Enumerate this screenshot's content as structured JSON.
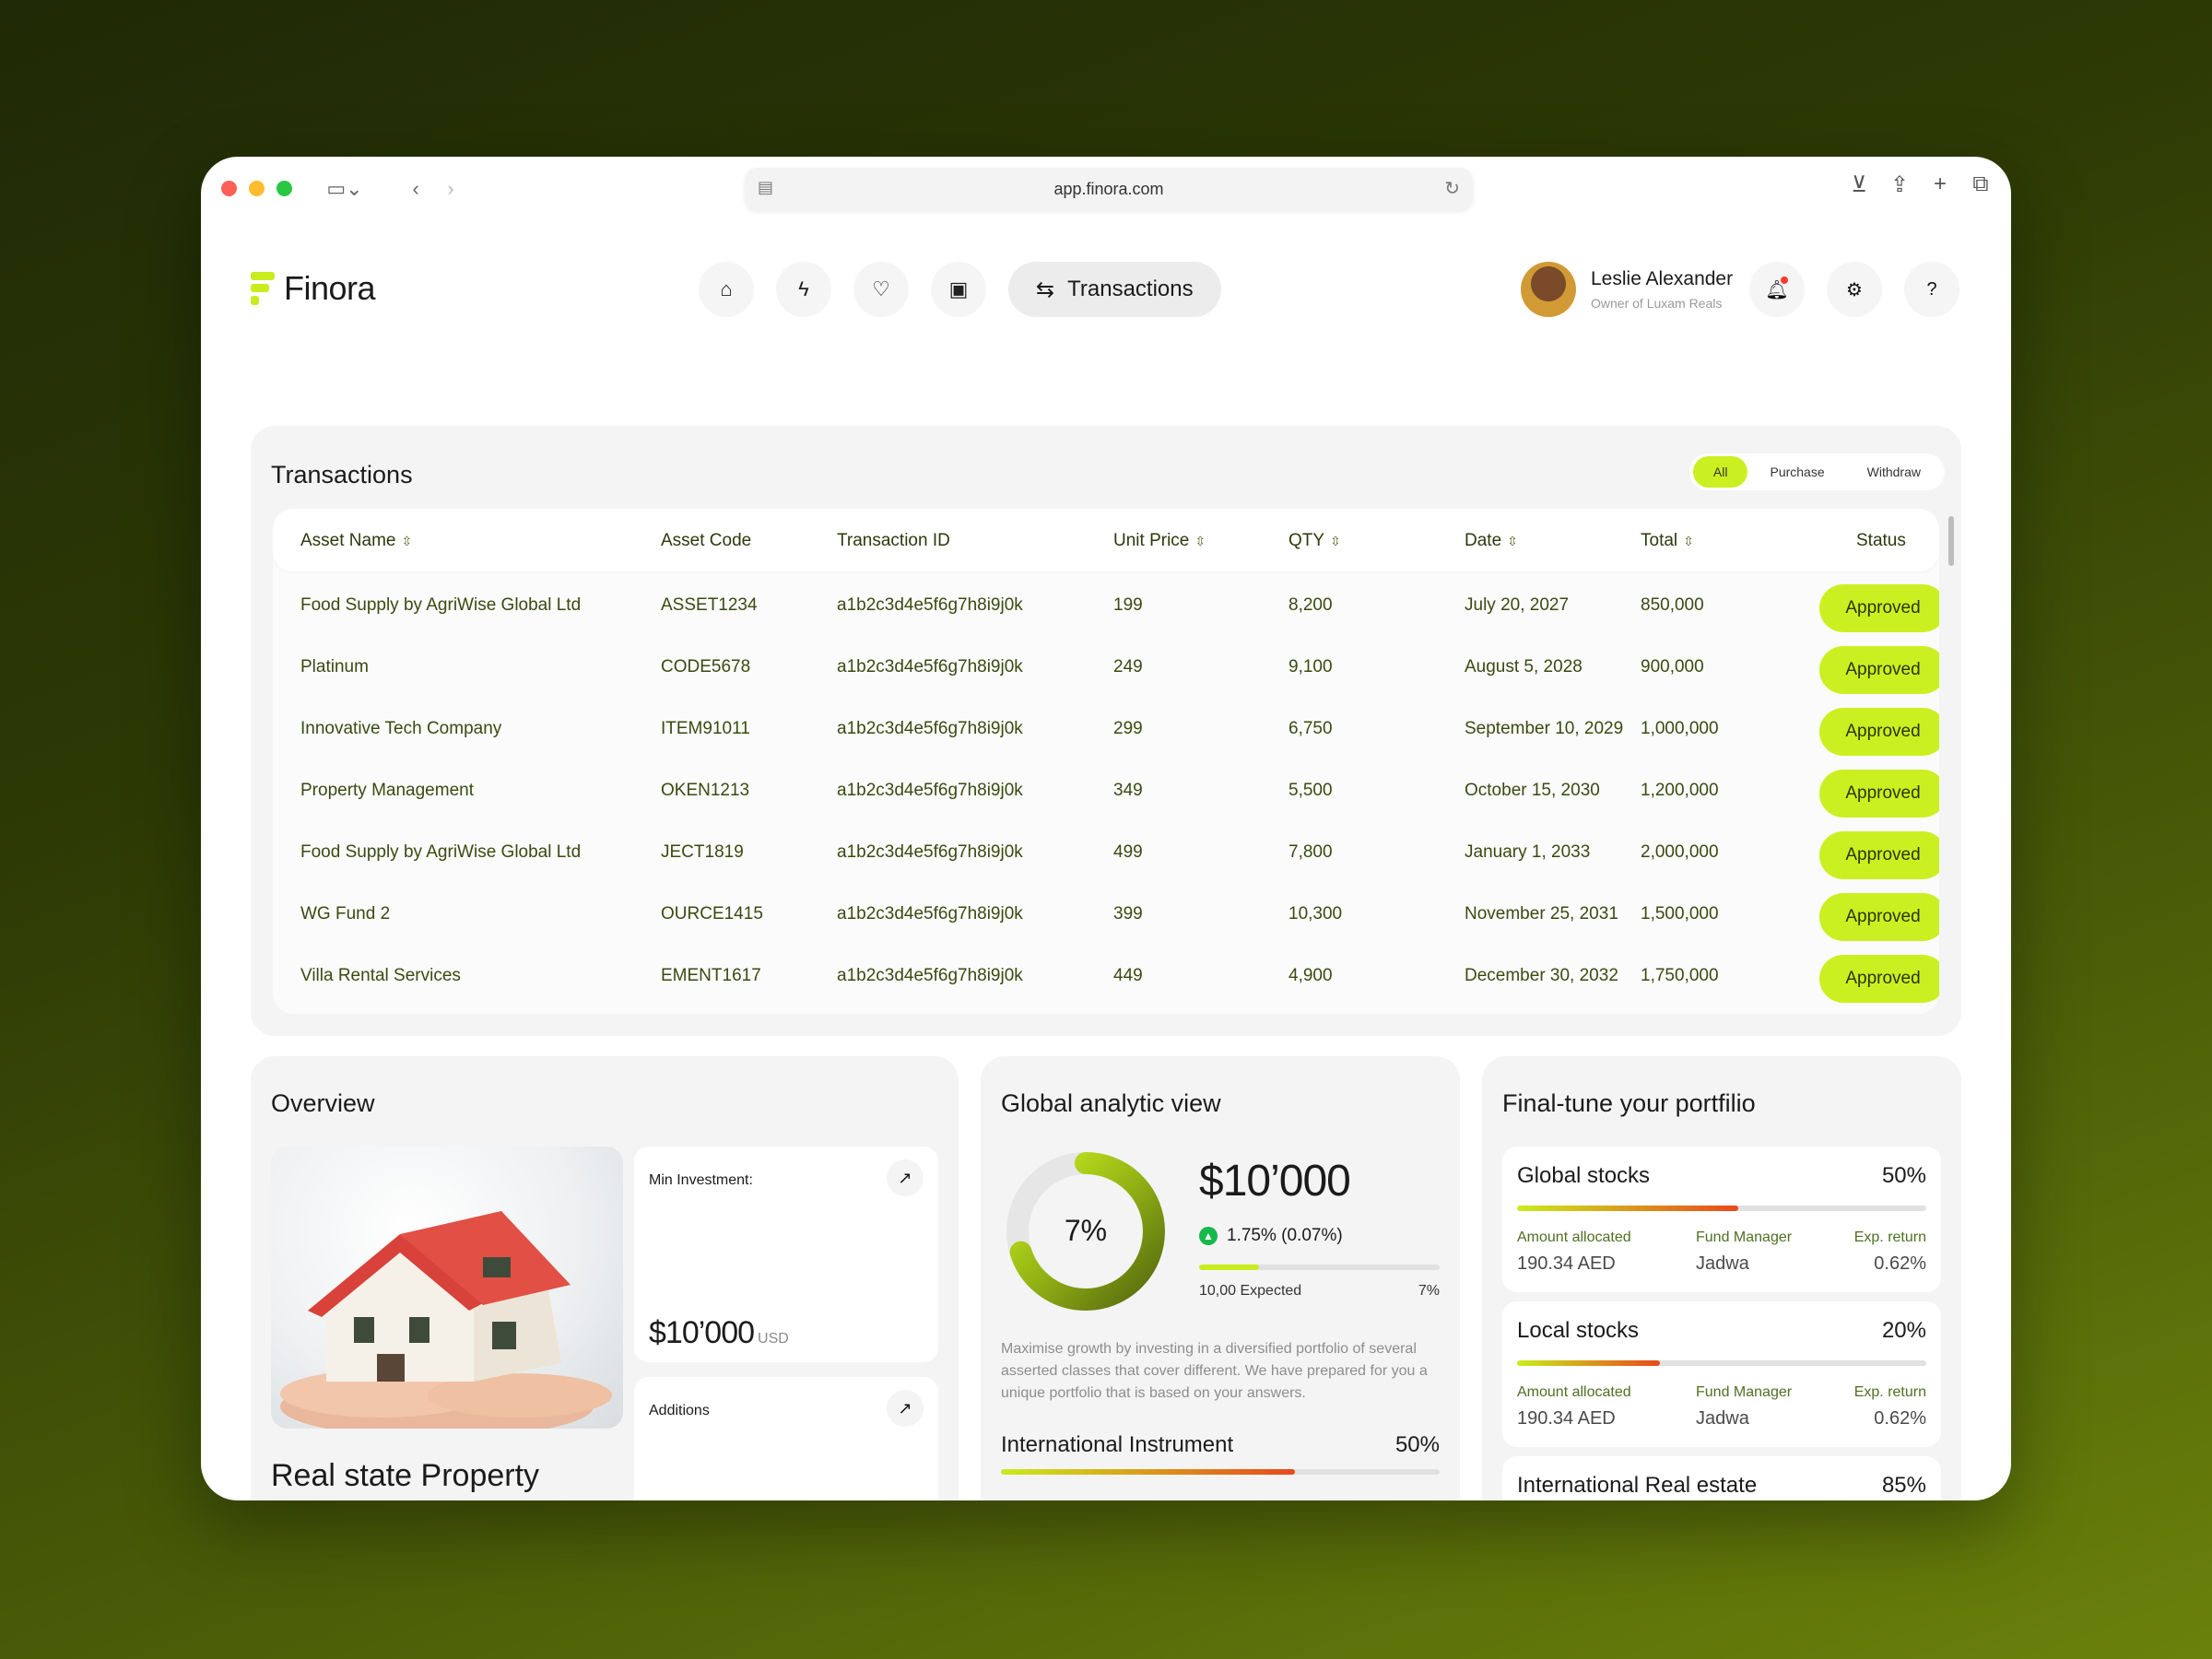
{
  "browser": {
    "url": "app.finora.com"
  },
  "app": {
    "name": "Finora",
    "active_nav": "Transactions",
    "user": {
      "name": "Leslie Alexander",
      "role": "Owner of Luxam Reals"
    }
  },
  "transactions": {
    "title": "Transactions",
    "tabs": [
      "All",
      "Purchase",
      "Withdraw"
    ],
    "active_tab": "All",
    "columns": [
      "Asset Name",
      "Asset Code",
      "Transaction ID",
      "Unit Price",
      "QTY",
      "Date",
      "Total",
      "Status"
    ],
    "rows": [
      {
        "asset": "Food Supply by AgriWise Global Ltd",
        "code": "ASSET1234",
        "tx": "a1b2c3d4e5f6g7h8i9j0k",
        "price": "199",
        "qty": "8,200",
        "date": "July 20, 2027",
        "total": "850,000",
        "status": "Approved"
      },
      {
        "asset": "Platinum",
        "code": "CODE5678",
        "tx": "a1b2c3d4e5f6g7h8i9j0k",
        "price": "249",
        "qty": "9,100",
        "date": "August 5, 2028",
        "total": "900,000",
        "status": "Approved"
      },
      {
        "asset": "Innovative Tech Company",
        "code": "ITEM91011",
        "tx": "a1b2c3d4e5f6g7h8i9j0k",
        "price": "299",
        "qty": "6,750",
        "date": "September 10, 2029",
        "total": "1,000,000",
        "status": "Approved"
      },
      {
        "asset": "Property Management",
        "code": "OKEN1213",
        "tx": "a1b2c3d4e5f6g7h8i9j0k",
        "price": "349",
        "qty": "5,500",
        "date": "October 15, 2030",
        "total": "1,200,000",
        "status": "Approved"
      },
      {
        "asset": "Food Supply by AgriWise Global Ltd",
        "code": "JECT1819",
        "tx": "a1b2c3d4e5f6g7h8i9j0k",
        "price": "499",
        "qty": "7,800",
        "date": "January 1, 2033",
        "total": "2,000,000",
        "status": "Approved"
      },
      {
        "asset": "WG Fund 2",
        "code": "OURCE1415",
        "tx": "a1b2c3d4e5f6g7h8i9j0k",
        "price": "399",
        "qty": "10,300",
        "date": "November 25, 2031",
        "total": "1,500,000",
        "status": "Approved"
      },
      {
        "asset": "Villa Rental Services",
        "code": "EMENT1617",
        "tx": "a1b2c3d4e5f6g7h8i9j0k",
        "price": "449",
        "qty": "4,900",
        "date": "December 30, 2032",
        "total": "1,750,000",
        "status": "Approved"
      }
    ]
  },
  "overview": {
    "title": "Overview",
    "min_investment_label": "Min Investment:",
    "min_investment_value": "$10’000",
    "min_investment_currency": "USD",
    "additions_label": "Additions",
    "property_title": "Real state Property"
  },
  "global_analytic": {
    "title": "Global analytic view",
    "donut_label": "7%",
    "donut_percent": 0.7,
    "value": "$10’000",
    "change": "1.75% (0.07%)",
    "expected_label": "10,00 Expected",
    "expected_pct": "7%",
    "expected_fill": 0.25,
    "description": "Maximise growth by investing in a diversified portfolio of several asserted classes that cover different. We have prepared for you a unique portfolio that is based on your answers.",
    "rows": [
      {
        "name": "International Instrument",
        "pct": "50%",
        "fill": 0.67
      }
    ]
  },
  "portfolio": {
    "title": "Final-tune your portfilio",
    "labels": {
      "allocated": "Amount allocated",
      "manager": "Fund Manager",
      "return": "Exp. return"
    },
    "items": [
      {
        "name": "Global stocks",
        "pct": "50%",
        "fill": 0.54,
        "allocated": "190.34 AED",
        "manager": "Jadwa",
        "return": "0.62%"
      },
      {
        "name": "Local stocks",
        "pct": "20%",
        "fill": 0.35,
        "allocated": "190.34 AED",
        "manager": "Jadwa",
        "return": "0.62%"
      },
      {
        "name": "International Real estate",
        "pct": "85%"
      }
    ]
  },
  "colors": {
    "accent": "#cbf021",
    "bar_gradient_start": "#c9ec1d",
    "bar_gradient_end": "#e9481b",
    "donut_dark": "#5a6e12",
    "donut_light": "#cbf021"
  }
}
